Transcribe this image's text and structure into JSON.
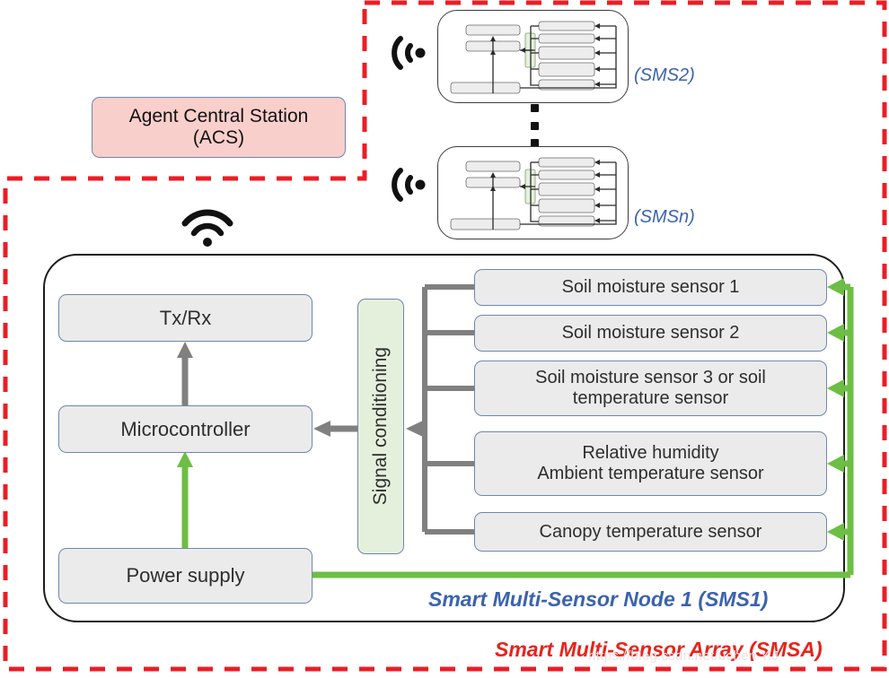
{
  "diagram": {
    "title_caption_array": "Smart Multi-Sensor Array (SMSA)",
    "title_caption_node": "Smart Multi-Sensor Node 1 (SMS1)"
  },
  "acs": {
    "line1": "Agent Central Station",
    "line2": "(ACS)"
  },
  "node": {
    "txrx": "Tx/Rx",
    "microcontroller": "Microcontroller",
    "power_supply": "Power supply",
    "signal_conditioning": "Signal conditioning"
  },
  "sensors": [
    {
      "label": "Soil moisture sensor 1"
    },
    {
      "label": "Soil moisture sensor 2"
    },
    {
      "label": "Soil moisture sensor 3 or soil temperature sensor"
    },
    {
      "label": "Relative humidity Ambient temperature sensor"
    },
    {
      "label": "Canopy temperature sensor"
    }
  ],
  "sensor_lines": {
    "s1": "Soil moisture sensor 1",
    "s2": "Soil moisture sensor 2",
    "s3a": "Soil moisture sensor 3 or soil",
    "s3b": "temperature sensor",
    "s4a": "Relative humidity",
    "s4b": "Ambient temperature sensor",
    "s5": "Canopy temperature sensor"
  },
  "other_nodes": [
    {
      "caption": "(SMS2)"
    },
    {
      "caption": "(SMSn)"
    }
  ],
  "captions": {
    "sms2": "(SMS2)",
    "smsn": "(SMSn)",
    "sms1": "Smart Multi-Sensor Node 1 (SMS1)",
    "smsa": "Smart Multi-Sensor Array (SMSA)"
  },
  "icons": {
    "wifi": "wifi-icon",
    "signal_sms2": "wireless-signal-icon",
    "signal_smsn": "wireless-signal-icon",
    "ellipsis": "vertical-ellipsis-icon"
  },
  "colors": {
    "boundary_red": "#ED1C24",
    "acs_fill": "#f9cfcc",
    "box_fill": "#ebebeb",
    "box_stroke": "#7087ad",
    "signal_fill": "#e5f0dc",
    "power_green": "#6DBE45",
    "data_gray": "#808080",
    "caption_blue": "#3b63ad",
    "caption_red": "#e8231a"
  },
  "watermark": "https://blog.csdn.net/uchen Y.J"
}
